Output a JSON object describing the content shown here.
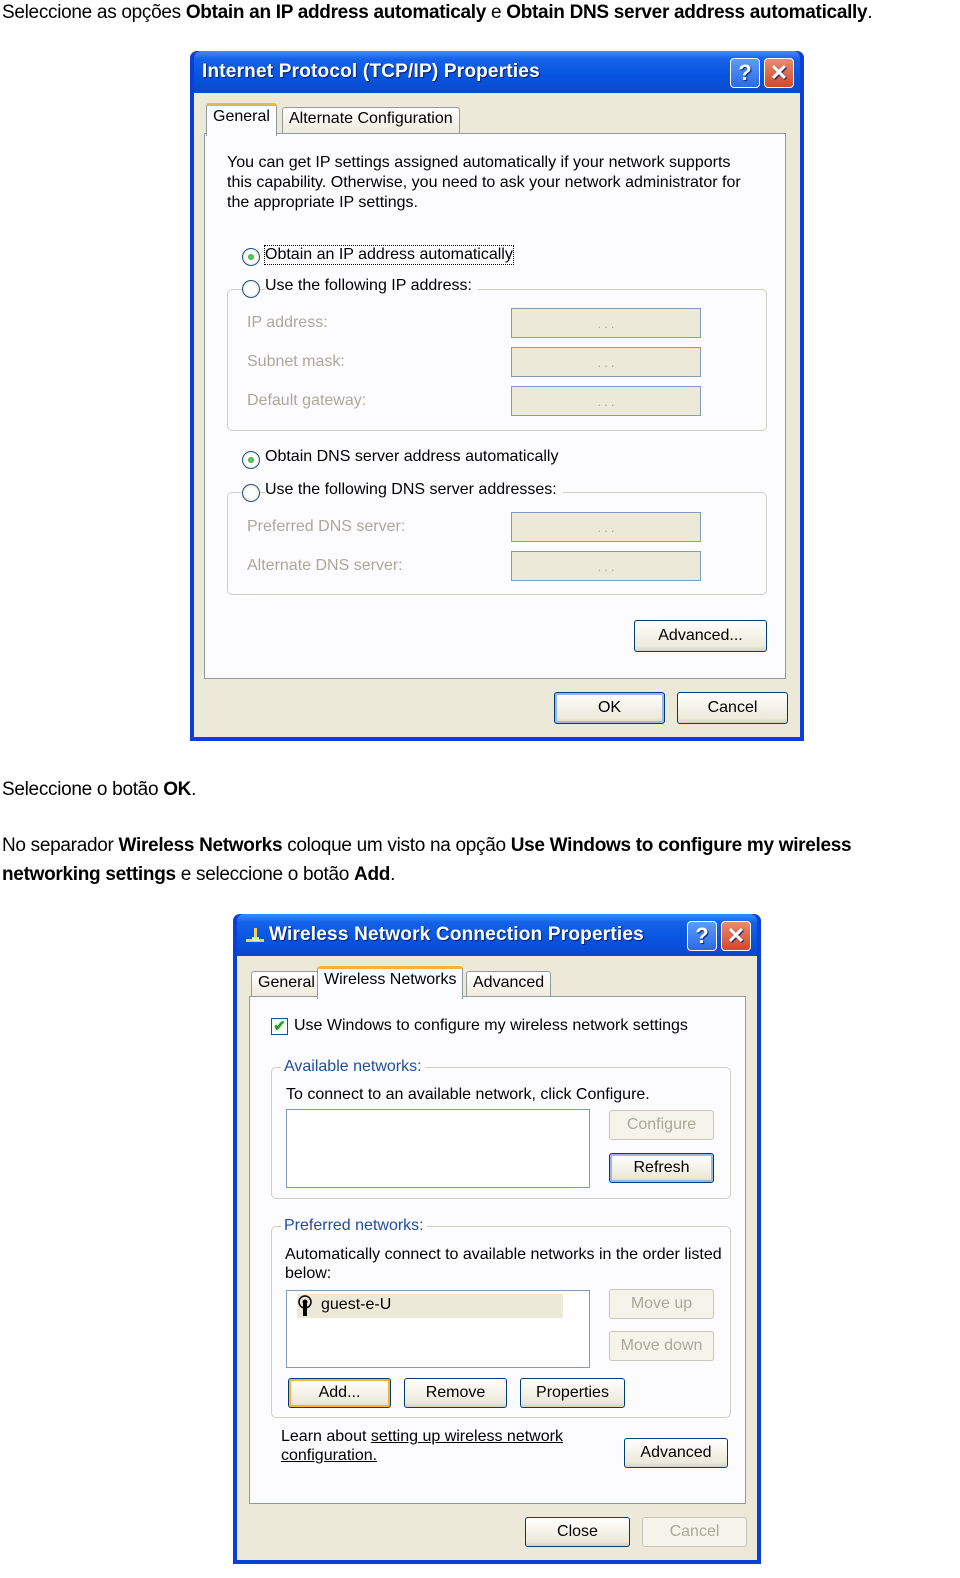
{
  "instructions": {
    "p1": {
      "prefix": "Seleccione as opções ",
      "b1": "Obtain an IP address automaticaly",
      "mid": " e ",
      "b2": "Obtain DNS server address automatically",
      "suffix": "."
    },
    "p2": {
      "prefix": "Seleccione o botão ",
      "b1": "OK",
      "suffix": "."
    },
    "p3": {
      "prefix": "No separador ",
      "b1": "Wireless Networks",
      "mid1": " coloque um visto na opção ",
      "b2": "Use Windows to configure my wireless networking settings",
      "mid2": " e seleccione o botão ",
      "b3": "Add",
      "suffix": "."
    }
  },
  "tcpip_dialog": {
    "title": "Internet Protocol (TCP/IP) Properties",
    "help_icon": "question-mark",
    "close_icon": "x",
    "tabs": [
      {
        "label": "General",
        "active": true
      },
      {
        "label": "Alternate Configuration",
        "active": false
      }
    ],
    "description": [
      "You can get IP settings assigned automatically if your network supports",
      "this capability. Otherwise, you need to ask your network administrator for",
      "the appropriate IP settings."
    ],
    "ip_mode": {
      "auto_label": "Obtain an IP address automatically",
      "manual_label": "Use the following IP address:",
      "selected": "auto"
    },
    "ip_fields": [
      {
        "label": "IP address:",
        "value": ". . ."
      },
      {
        "label": "Subnet mask:",
        "value": ". . ."
      },
      {
        "label": "Default gateway:",
        "value": ". . ."
      }
    ],
    "dns_mode": {
      "auto_label": "Obtain DNS server address automatically",
      "manual_label": "Use the following DNS server addresses:",
      "selected": "auto"
    },
    "dns_fields": [
      {
        "label": "Preferred DNS server:",
        "value": ". . ."
      },
      {
        "label": "Alternate DNS server:",
        "value": ". . ."
      }
    ],
    "advanced_label": "Advanced...",
    "ok_label": "OK",
    "cancel_label": "Cancel"
  },
  "wireless_dialog": {
    "title": "Wireless Network Connection Properties",
    "title_icon": "network-connection",
    "tabs": [
      {
        "label": "General",
        "active": false
      },
      {
        "label": "Wireless Networks",
        "active": true
      },
      {
        "label": "Advanced",
        "active": false
      }
    ],
    "use_windows_label": "Use Windows to configure my wireless network settings",
    "use_windows_checked": true,
    "available": {
      "group_label": "Available networks:",
      "hint": "To connect to an available network, click Configure.",
      "items": [],
      "configure_label": "Configure",
      "refresh_label": "Refresh"
    },
    "preferred": {
      "group_label": "Preferred networks:",
      "hint_line1": "Automatically connect to available networks in the order listed",
      "hint_line2": "below:",
      "items": [
        {
          "name": "guest-e-U",
          "icon": "wireless-antenna"
        }
      ],
      "move_up_label": "Move up",
      "move_down_label": "Move down",
      "add_label": "Add...",
      "remove_label": "Remove",
      "properties_label": "Properties"
    },
    "learn_prefix": "Learn about ",
    "learn_link_line1": "setting up wireless network",
    "learn_link_line2": "configuration.",
    "advanced_label": "Advanced",
    "close_label": "Close",
    "cancel_label": "Cancel"
  }
}
